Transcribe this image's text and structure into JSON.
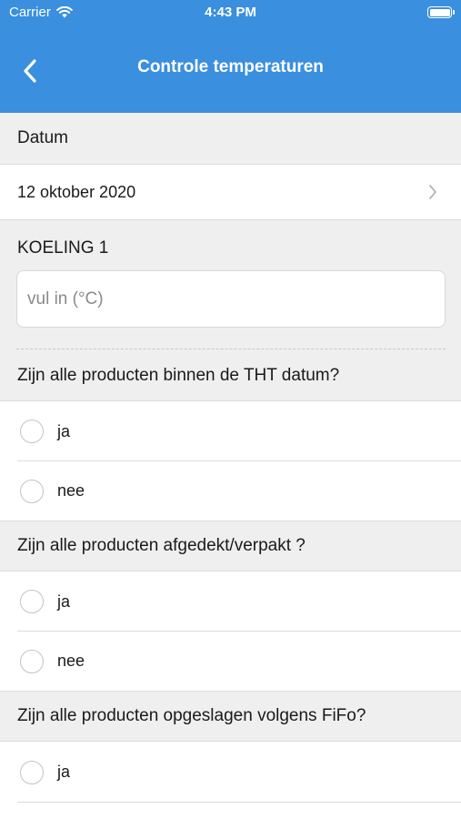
{
  "status_bar": {
    "carrier": "Carrier",
    "time": "4:43 PM"
  },
  "nav": {
    "title": "Controle temperaturen",
    "back_icon": "chevron-left-icon"
  },
  "date_section": {
    "label": "Datum",
    "value": "12 oktober 2020"
  },
  "temperature": {
    "label": "KOELING 1",
    "placeholder": "vul in (°C)",
    "value": ""
  },
  "questions": [
    {
      "text": "Zijn alle producten binnen de THT datum?",
      "options": [
        "ja",
        "nee"
      ]
    },
    {
      "text": "Zijn alle producten afgedekt/verpakt ?",
      "options": [
        "ja",
        "nee"
      ]
    },
    {
      "text": "Zijn alle producten opgeslagen volgens FiFo?",
      "options": [
        "ja"
      ]
    }
  ],
  "colors": {
    "header": "#3a8fde",
    "background": "#efefef"
  }
}
